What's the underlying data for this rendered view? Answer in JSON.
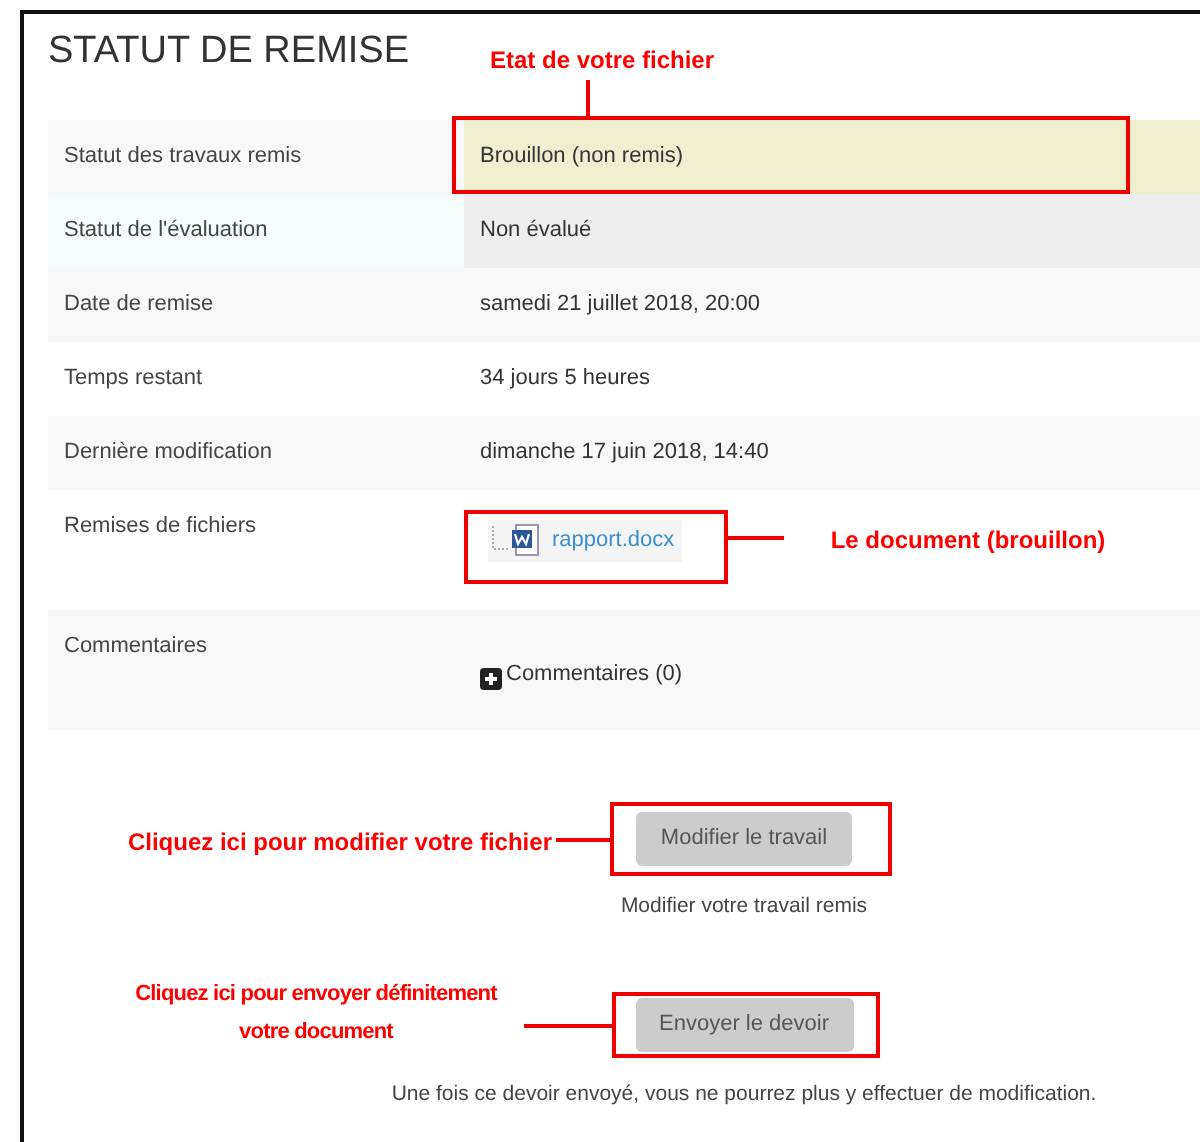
{
  "title": "STATUT DE REMISE",
  "rows": [
    {
      "kind": "text",
      "label": "Statut des travaux remis",
      "value": "Brouillon (non remis)",
      "color": "#efefd0"
    },
    {
      "kind": "text",
      "label": "Statut de l'évaluation",
      "value": "Non évalué",
      "color": "#eeeeee"
    },
    {
      "kind": "text",
      "label": "Date de remise",
      "value": "samedi 21 juillet 2018, 20:00"
    },
    {
      "kind": "text",
      "label": "Temps restant",
      "value": "34 jours 5 heures"
    },
    {
      "kind": "text",
      "label": "Dernière modification",
      "value": "dimanche 17 juin 2018, 14:40"
    },
    {
      "kind": "file",
      "label": "Remises de fichiers",
      "value": "rapport.docx"
    },
    {
      "kind": "comments",
      "label": "Commentaires",
      "value": "Commentaires (0)"
    }
  ],
  "actions": [
    {
      "button": "Modifier le travail",
      "note": "Modifier votre travail remis"
    },
    {
      "button": "Envoyer le devoir",
      "note": "Une fois ce devoir envoyé, vous ne pourrez plus y effectuer de modification."
    }
  ],
  "annotations": [
    "Etat de votre fichier",
    "Le document (brouillon)",
    "Cliquez ici pour modifier votre fichier",
    "Cliquez ici pour envoyer définitement votre document"
  ]
}
